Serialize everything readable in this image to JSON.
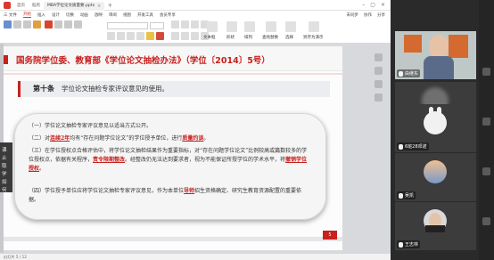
{
  "app": {
    "tabs": [
      {
        "label": "首页",
        "active": false
      },
      {
        "label": "稻壳",
        "active": false
      },
      {
        "label": "MBA学位论文质量要.pptx",
        "active": true
      }
    ],
    "menu": [
      "三 文件",
      "开始",
      "插入",
      "设计",
      "切换",
      "动画",
      "放映",
      "审阅",
      "视图",
      "开发工具",
      "会员专享"
    ],
    "menu_right": [
      "未同步",
      "协作",
      "分享"
    ],
    "toolbar_labels": [
      "文本框",
      "形状",
      "排列",
      "查找替换",
      "选择",
      "另存为演示"
    ],
    "status_text": "幻灯片 5 / 12"
  },
  "slide": {
    "title": "国务院学位委、教育部《学位论文抽检办法》（学位〔2014〕5号）",
    "article_no": "第十条",
    "article_text": "学位论文抽检专家评议意见的使用。",
    "paragraphs": [
      {
        "parts": [
          {
            "t": "（一）学位论文抽检专家评议意见以适当方式公开。",
            "hl": false
          }
        ]
      },
      {
        "parts": [
          {
            "t": "（二）对",
            "hl": false
          },
          {
            "t": "连续2年",
            "hl": true
          },
          {
            "t": "均有“存在问题学位论文”的学位授予单位，进行",
            "hl": false
          },
          {
            "t": "质量约谈",
            "hl": true
          },
          {
            "t": "。",
            "hl": false
          }
        ]
      },
      {
        "parts": [
          {
            "t": "（三）在学位授权点合格评估中，将学位论文抽检结果作为重要指标，对“存在问题学位论文”比例较高或篇数较多的学位授权点，依据有关程序，",
            "hl": false
          },
          {
            "t": "责令限期整改",
            "hl": true
          },
          {
            "t": "。经整改仍无法达到要求者，视为不能保证所授学位的学术水平，将",
            "hl": false
          },
          {
            "t": "撤销学位授权",
            "hl": true
          },
          {
            "t": "。",
            "hl": false
          }
        ]
      },
      {
        "parts": [
          {
            "t": "（四）学位授予单位应将学位论文抽检专家评议意见，作为本单位",
            "hl": false
          },
          {
            "t": "导师",
            "hl": true
          },
          {
            "t": "招生资格确定、研究生教育资源配置的重要依据。",
            "hl": false
          }
        ]
      }
    ],
    "page": "5",
    "colors": {
      "accent": "#c8201c"
    }
  },
  "overlay": {
    "text": "课止取学如何"
  },
  "meeting": {
    "participants": [
      {
        "name": "由继东",
        "avatar": "person-avatar"
      },
      {
        "name": "",
        "avatar": "face-blur"
      },
      {
        "name": "6班28邓诺",
        "avatar": "rabbit-avatar"
      },
      {
        "name": "吴凯",
        "avatar": "landscape-avatar"
      },
      {
        "name": "王志林",
        "avatar": "person-suit-avatar"
      }
    ]
  }
}
